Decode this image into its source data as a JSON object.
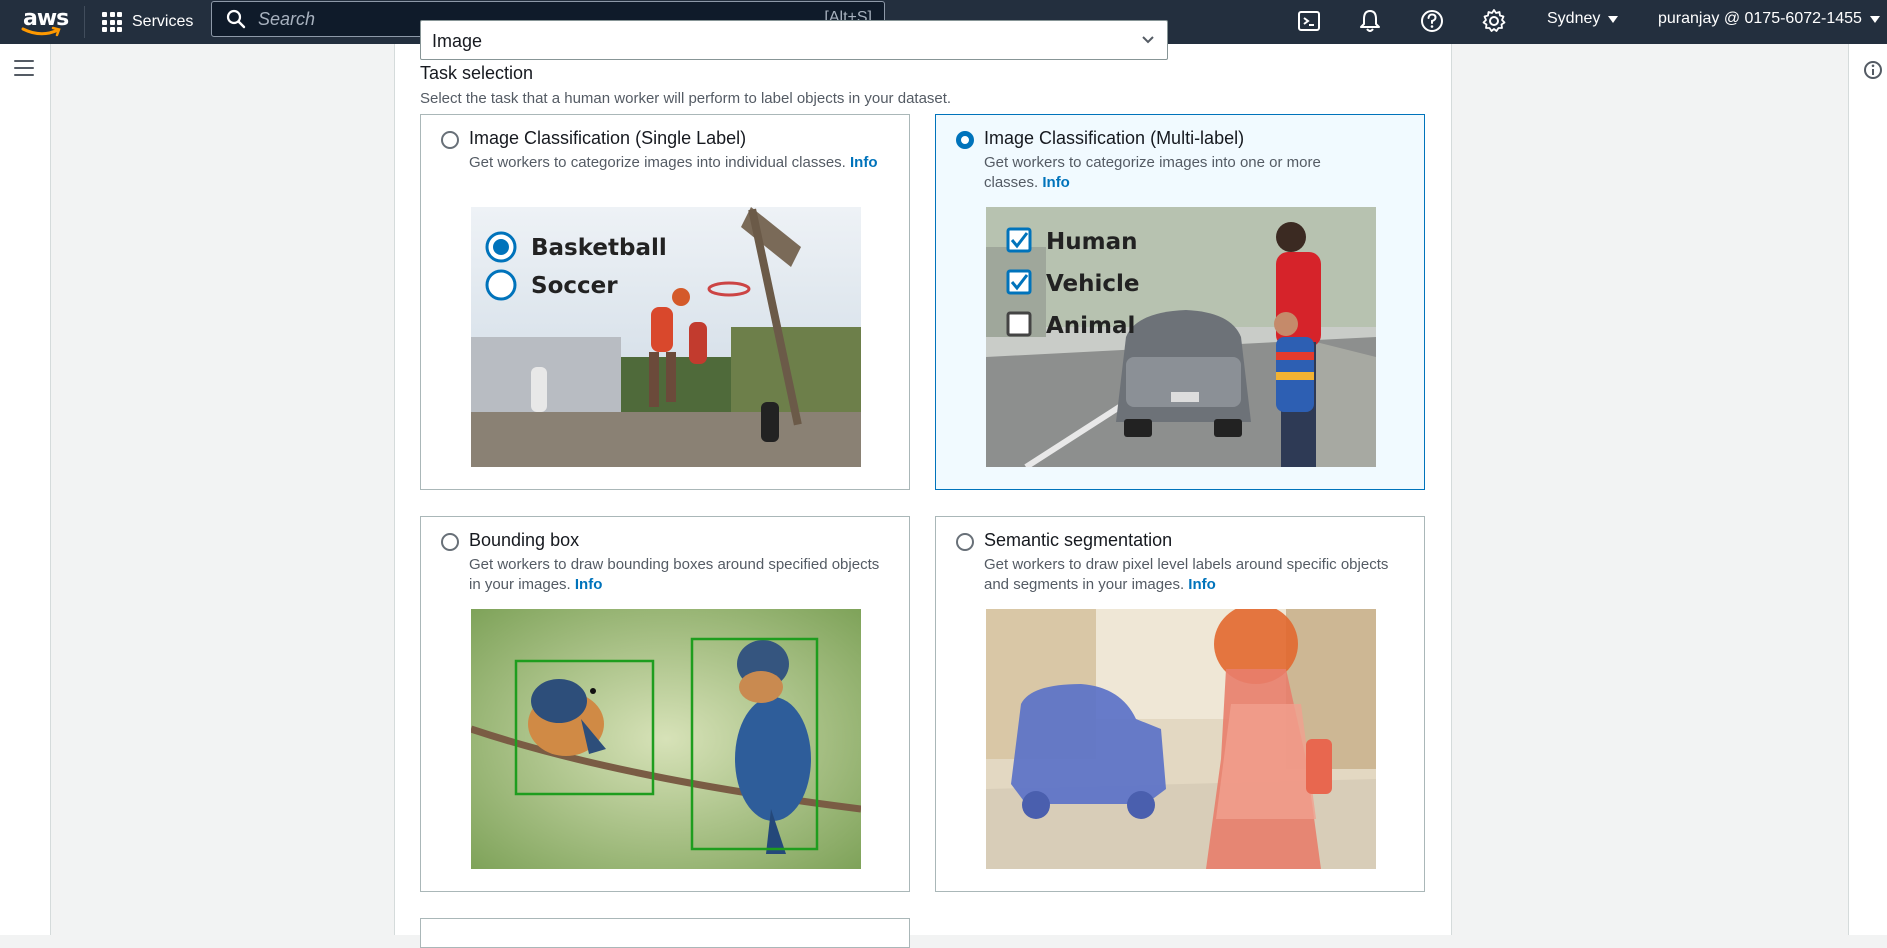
{
  "topnav": {
    "logo_text": "aws",
    "services_label": "Services",
    "search_placeholder": "Search",
    "search_shortcut": "[Alt+S]",
    "region": "Sydney",
    "account": "puranjay @ 0175-6072-1455",
    "icons": [
      "cloudshell-icon",
      "notifications-icon",
      "help-icon",
      "settings-icon"
    ]
  },
  "data_type_select": {
    "value": "Image"
  },
  "task_selection": {
    "title": "Task selection",
    "description": "Select the task that a human worker will perform to label objects in your dataset.",
    "info_label": "Info",
    "selected": "Image Classification (Multi-label)",
    "tiles": [
      {
        "title": "Image Classification (Single Label)",
        "description": "Get workers to categorize images into individual classes.",
        "selected": false,
        "image_labels": [
          "Basketball",
          "Soccer"
        ]
      },
      {
        "title": "Image Classification (Multi-label)",
        "description": "Get workers to categorize images into one or more classes.",
        "selected": true,
        "image_labels": [
          "Human",
          "Vehicle",
          "Animal"
        ],
        "image_checked": [
          true,
          true,
          false
        ]
      },
      {
        "title": "Bounding box",
        "description": "Get workers to draw bounding boxes around specified objects in your images.",
        "selected": false
      },
      {
        "title": "Semantic segmentation",
        "description": "Get workers to draw pixel level labels around specific objects and segments in your images.",
        "selected": false
      }
    ]
  },
  "colors": {
    "nav_bg": "#232f3e",
    "accent": "#0073bb",
    "selected_bg": "#f1faff"
  }
}
